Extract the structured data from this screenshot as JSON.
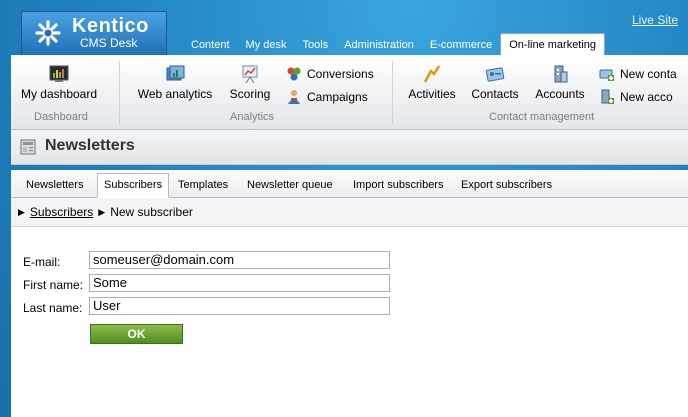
{
  "header": {
    "logo_title": "Kentico",
    "logo_subtitle": "CMS Desk",
    "live_site": "Live Site"
  },
  "top_tabs": [
    {
      "label": "Content"
    },
    {
      "label": "My desk"
    },
    {
      "label": "Tools"
    },
    {
      "label": "Administration"
    },
    {
      "label": "E-commerce"
    },
    {
      "label": "On-line marketing",
      "active": true
    }
  ],
  "ribbon": {
    "dashboard": {
      "button": "My dashboard",
      "group": "Dashboard"
    },
    "analytics": {
      "web_analytics": "Web analytics",
      "scoring": "Scoring",
      "conversions": "Conversions",
      "campaigns": "Campaigns",
      "group": "Analytics"
    },
    "contact_management": {
      "activities": "Activities",
      "contacts": "Contacts",
      "accounts": "Accounts",
      "new_contact": "New conta",
      "new_account": "New acco",
      "group": "Contact management"
    }
  },
  "page_title": "Newsletters",
  "sub_tabs": [
    {
      "label": "Newsletters"
    },
    {
      "label": "Subscribers",
      "active": true
    },
    {
      "label": "Templates"
    },
    {
      "label": "Newsletter queue"
    },
    {
      "label": "Import subscribers"
    },
    {
      "label": "Export subscribers"
    }
  ],
  "breadcrumb": {
    "parent": "Subscribers",
    "current": "New subscriber"
  },
  "form": {
    "email": {
      "label": "E-mail:",
      "value": "someuser@domain.com"
    },
    "first_name": {
      "label": "First name:",
      "value": "Some"
    },
    "last_name": {
      "label": "Last name:",
      "value": "User"
    },
    "ok_label": "OK"
  },
  "colors": {
    "background": "#1f7fbd",
    "ok_button": "#5f9e2a"
  }
}
